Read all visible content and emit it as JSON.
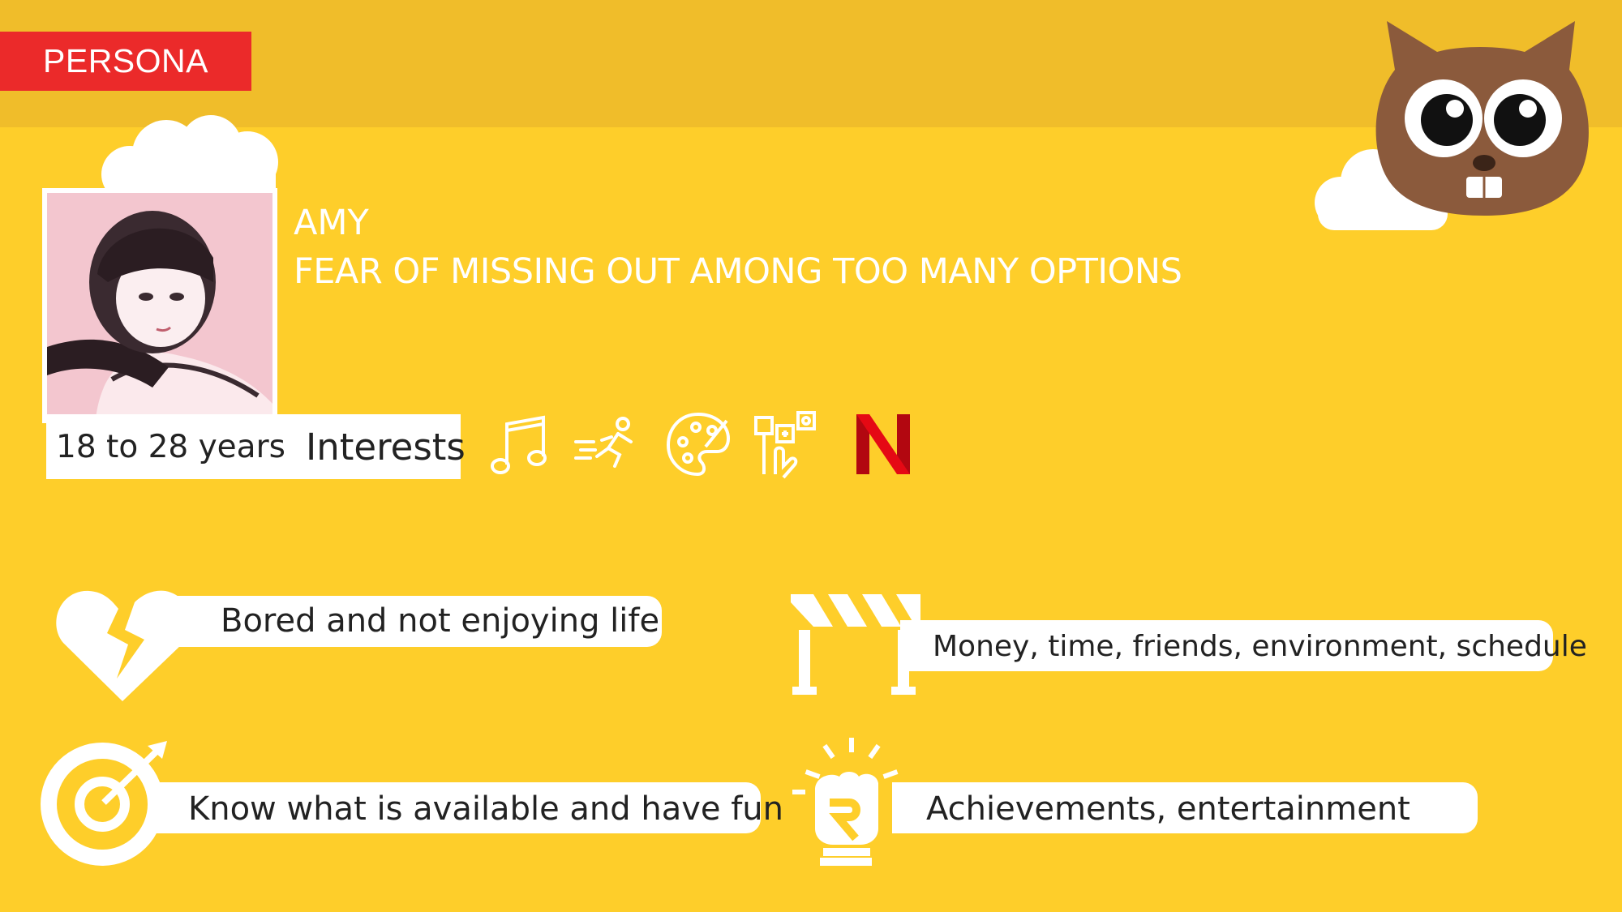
{
  "section_tag": "PERSONA",
  "persona": {
    "name": "AMY",
    "tagline": "FEAR OF MISSING OUT AMONG TOO MANY OPTIONS",
    "age": "18 to 28 years",
    "interests_label": "Interests",
    "interests": [
      {
        "icon": "music-note-icon"
      },
      {
        "icon": "running-person-icon"
      },
      {
        "icon": "paint-palette-icon"
      },
      {
        "icon": "social-media-hand-icon"
      },
      {
        "icon": "netflix-logo-icon",
        "color": "#e50914"
      }
    ]
  },
  "cards": {
    "pain": {
      "icon": "broken-heart-icon",
      "text": "Bored and not enjoying life"
    },
    "barriers": {
      "icon": "road-barrier-icon",
      "text": "Money, time, friends, environment, schedule"
    },
    "goal": {
      "icon": "target-icon",
      "text": "Know what is available and have fun"
    },
    "motivation": {
      "icon": "raised-fist-icon",
      "text": "Achievements, entertainment"
    }
  },
  "colors": {
    "background": "#fece2a",
    "top_band": "#f0bd2a",
    "tag": "#eb2a2a",
    "mascot": "#8b5a3c"
  }
}
